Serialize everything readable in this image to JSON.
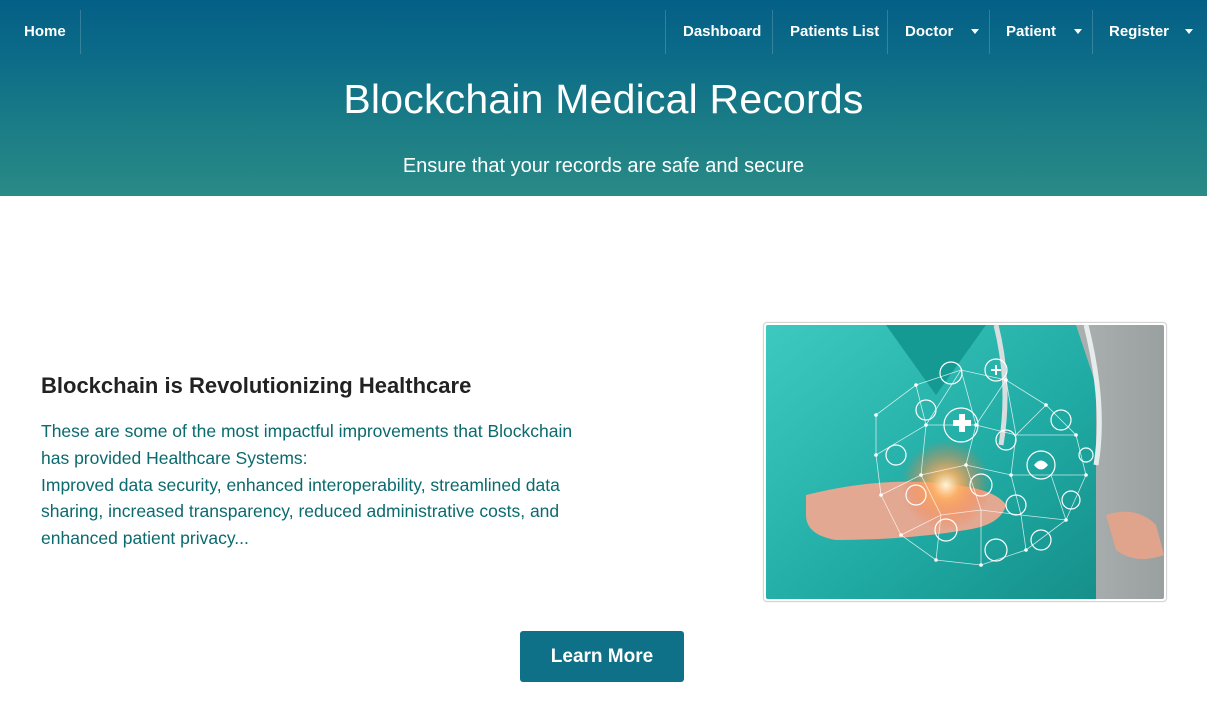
{
  "nav": {
    "home": "Home",
    "dashboard": "Dashboard",
    "patients_list": "Patients List",
    "doctor": "Doctor",
    "patient": "Patient",
    "register": "Register"
  },
  "hero": {
    "title": "Blockchain Medical Records",
    "subtitle": "Ensure that your records are safe and secure"
  },
  "section": {
    "title": "Blockchain is Revolutionizing Healthcare",
    "paragraph1": "These are some of the most impactful improvements that Blockchain has provided Healthcare Systems:",
    "paragraph2": "Improved data security, enhanced interoperability, streamlined data sharing, increased transparency, reduced administrative costs, and enhanced patient privacy..."
  },
  "image": {
    "icon": "doctor-holding-medical-network-image"
  },
  "cta": {
    "label": "Learn More"
  },
  "colors": {
    "header_top": "#045f86",
    "header_bottom": "#2a8a86",
    "body_text": "#0a6a6e",
    "button": "#0e7187"
  }
}
